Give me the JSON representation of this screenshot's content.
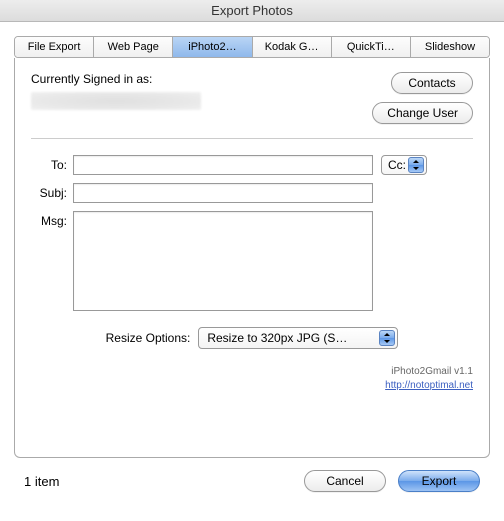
{
  "window": {
    "title": "Export Photos"
  },
  "tabs": [
    {
      "label": "File Export"
    },
    {
      "label": "Web Page"
    },
    {
      "label": "iPhoto2…"
    },
    {
      "label": "Kodak G…"
    },
    {
      "label": "QuickTi…"
    },
    {
      "label": "Slideshow"
    }
  ],
  "signin": {
    "label": "Currently Signed in as:"
  },
  "buttons": {
    "contacts": "Contacts",
    "change_user": "Change User",
    "cancel": "Cancel",
    "export": "Export"
  },
  "form": {
    "to_label": "To:",
    "subj_label": "Subj:",
    "msg_label": "Msg:",
    "cc_label": "Cc:",
    "to_value": "",
    "subj_value": "",
    "msg_value": ""
  },
  "resize": {
    "label": "Resize Options:",
    "selected": "Resize to 320px JPG (S…"
  },
  "footer": {
    "version": "iPhoto2Gmail v1.1",
    "link": "http://notoptimal.net"
  },
  "status": {
    "item_count": "1 item"
  }
}
